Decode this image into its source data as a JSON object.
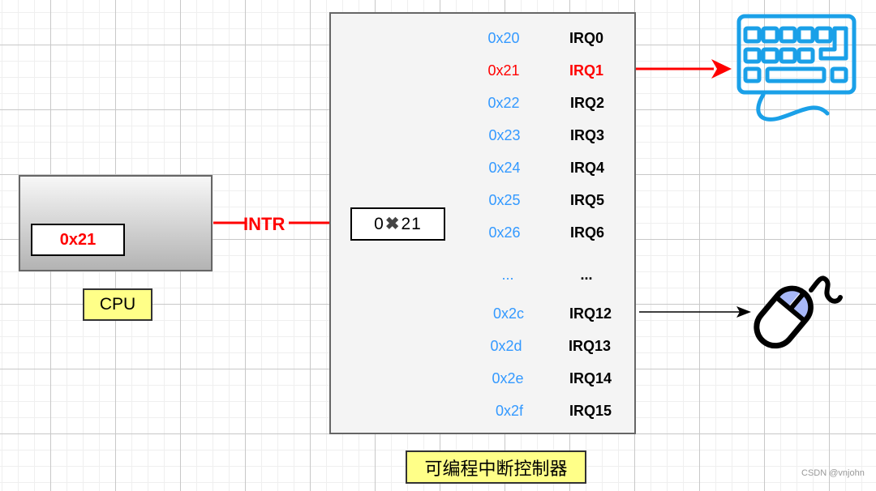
{
  "cpu": {
    "label": "CPU",
    "register_value": "0x21"
  },
  "bus": {
    "signal_label": "INTR",
    "color": "#ff0000"
  },
  "pic": {
    "label": "可编程中断控制器",
    "register_prefix": "0",
    "register_x_glyph": "✖",
    "register_suffix": "21",
    "rows": [
      {
        "address": "0x20",
        "irq": "IRQ0",
        "highlighted": false
      },
      {
        "address": "0x21",
        "irq": "IRQ1",
        "highlighted": true
      },
      {
        "address": "0x22",
        "irq": "IRQ2",
        "highlighted": false
      },
      {
        "address": "0x23",
        "irq": "IRQ3",
        "highlighted": false
      },
      {
        "address": "0x24",
        "irq": "IRQ4",
        "highlighted": false
      },
      {
        "address": "0x25",
        "irq": "IRQ5",
        "highlighted": false
      },
      {
        "address": "0x26",
        "irq": "IRQ6",
        "highlighted": false
      },
      {
        "address": "...",
        "irq": "...",
        "highlighted": false
      },
      {
        "address": "0x2c",
        "irq": "IRQ12",
        "highlighted": false
      },
      {
        "address": "0x2d",
        "irq": "IRQ13",
        "highlighted": false
      },
      {
        "address": "0x2e",
        "irq": "IRQ14",
        "highlighted": false
      },
      {
        "address": "0x2f",
        "irq": "IRQ15",
        "highlighted": false
      }
    ]
  },
  "devices": {
    "keyboard": {
      "icon": "keyboard-icon",
      "connected_irq": "IRQ1",
      "color": "#1aa0e8"
    },
    "mouse": {
      "icon": "mouse-icon",
      "connected_irq": "IRQ12",
      "accent": "#a8b8f8"
    }
  },
  "colors": {
    "address": "#3399ff",
    "highlight": "#ff0000",
    "label_bg": "#ffff88"
  },
  "watermark": "CSDN @vnjohn"
}
